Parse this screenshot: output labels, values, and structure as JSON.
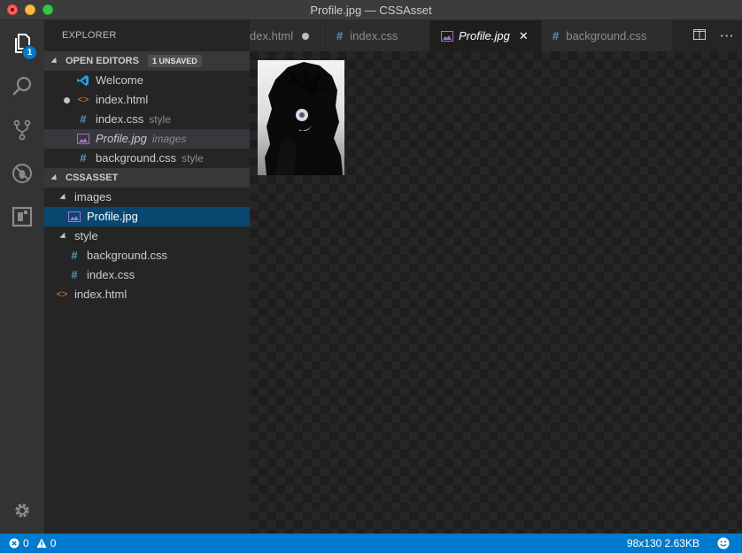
{
  "window": {
    "title": "Profile.jpg — CSSAsset"
  },
  "activity": {
    "explorer_badge": "1"
  },
  "sidebar": {
    "title": "EXPLORER",
    "open_editors": {
      "header": "OPEN EDITORS",
      "badge": "1 UNSAVED",
      "items": [
        {
          "label": "Welcome",
          "desc": ""
        },
        {
          "label": "index.html",
          "desc": ""
        },
        {
          "label": "index.css",
          "desc": "style"
        },
        {
          "label": "Profile.jpg",
          "desc": "images"
        },
        {
          "label": "background.css",
          "desc": "style"
        }
      ]
    },
    "project": {
      "header": "CSSASSET",
      "items": [
        {
          "label": "images"
        },
        {
          "label": "Profile.jpg"
        },
        {
          "label": "style"
        },
        {
          "label": "background.css"
        },
        {
          "label": "index.css"
        },
        {
          "label": "index.html"
        }
      ]
    }
  },
  "tabs": [
    {
      "label": "dex.html"
    },
    {
      "label": "index.css"
    },
    {
      "label": "Profile.jpg"
    },
    {
      "label": "background.css"
    }
  ],
  "status": {
    "errors": "0",
    "warnings": "0",
    "image_info": "98x130 2.63KB"
  },
  "colors": {
    "accent": "#007acc",
    "selection": "#094771",
    "css_icon": "#519aba",
    "html_icon": "#e37933",
    "image_icon": "#a074c4"
  }
}
